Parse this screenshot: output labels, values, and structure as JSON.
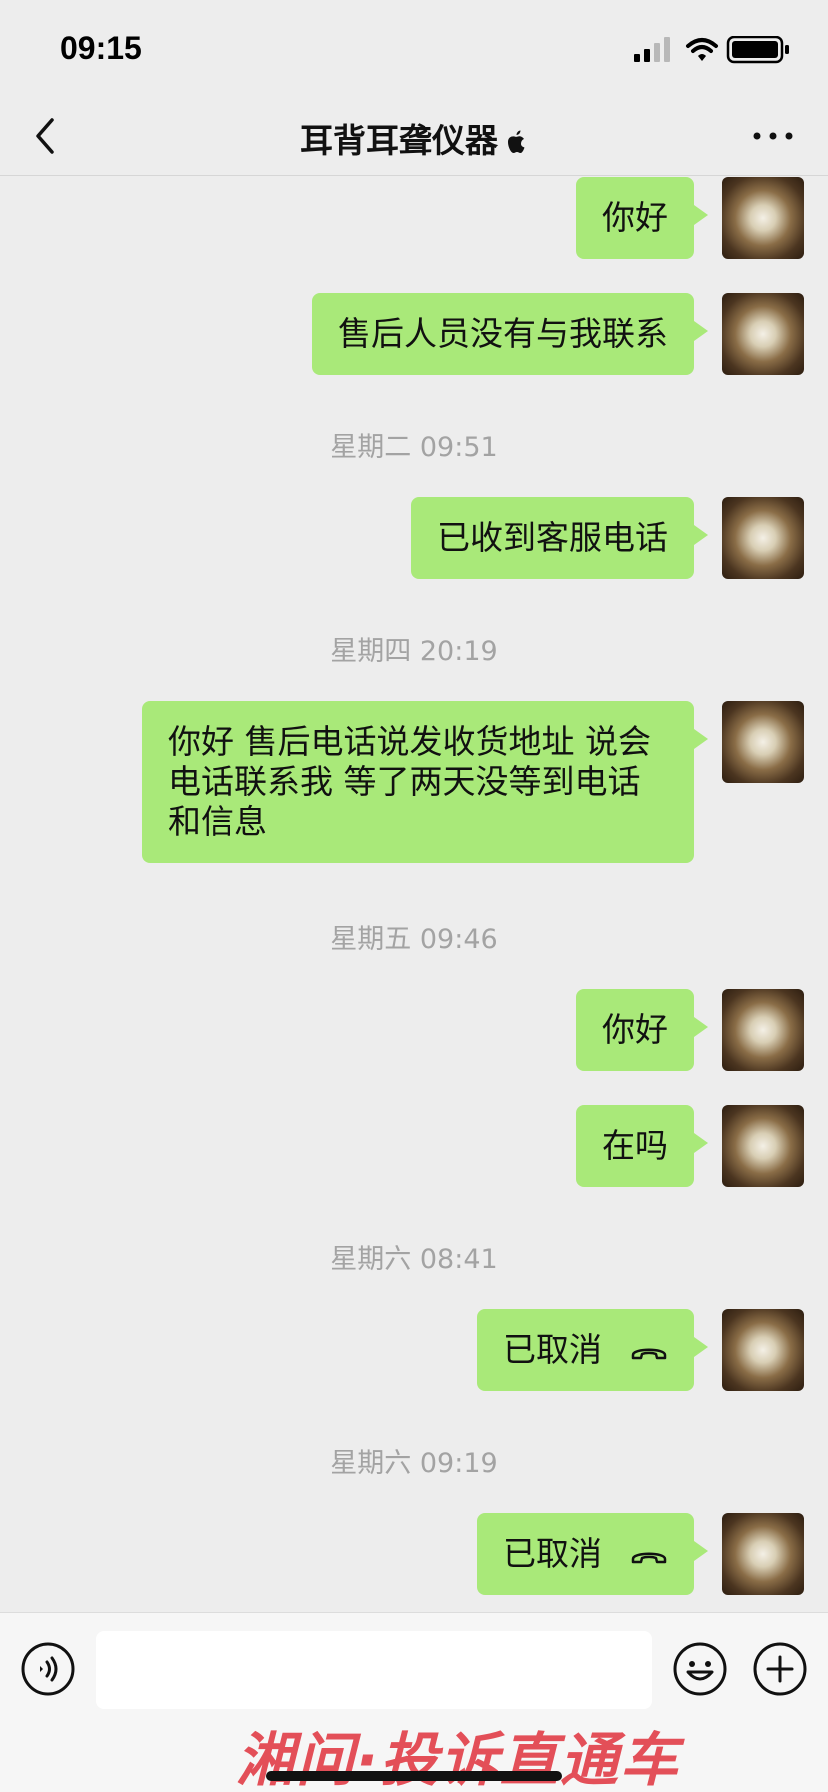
{
  "status_bar": {
    "time": "09:15"
  },
  "header": {
    "title": "耳背耳聋仪器"
  },
  "messages": [
    {
      "text": "你好"
    },
    {
      "text": "售后人员没有与我联系"
    },
    {
      "timestamp": "星期二 09:51"
    },
    {
      "text": "已收到客服电话"
    },
    {
      "timestamp": "星期四 20:19"
    },
    {
      "text_lines": [
        "你好 售后电话说发收货地址 说会",
        "电话联系我 等了两天没等到电话",
        "和信息"
      ]
    },
    {
      "timestamp": "星期五 09:46"
    },
    {
      "text": "你好"
    },
    {
      "text": "在吗"
    },
    {
      "timestamp": "星期六 08:41"
    },
    {
      "text": "已取消",
      "icon": "phone-hangup-icon"
    },
    {
      "timestamp": "星期六 09:19"
    },
    {
      "text": "已取消",
      "icon": "phone-hangup-icon"
    }
  ],
  "input": {
    "value": "",
    "placeholder": ""
  },
  "watermark": "湘问·投诉直通车",
  "colors": {
    "bubble": "#a9e979",
    "background": "#ededed",
    "watermark": "#e0323d"
  }
}
